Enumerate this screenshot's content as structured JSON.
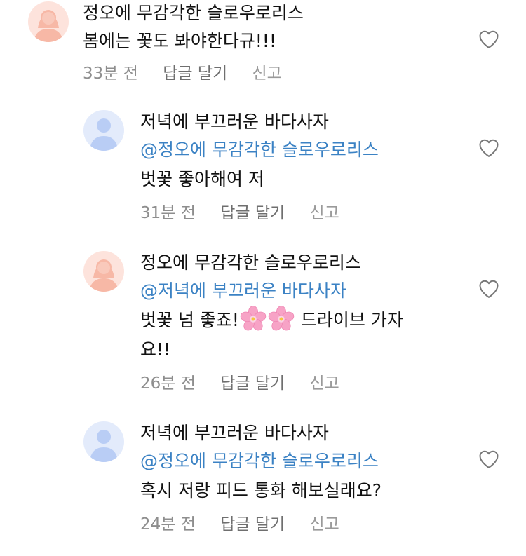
{
  "comments": [
    {
      "username": "정오에 무감각한 슬로우로리스",
      "text": "봄에는 꽃도 봐야한다규!!!",
      "time": "33분 전",
      "reply_label": "답글 달기",
      "report_label": "신고",
      "avatar_color": "#f7b8a6",
      "like_icon": "heart-outline-icon"
    }
  ],
  "replies": [
    {
      "username": "저녁에 부끄러운 바다사자",
      "mention": "@정오에 무감각한 슬로우로리스",
      "text": "벗꽃 좋아해여 저",
      "time": "31분 전",
      "reply_label": "답글 달기",
      "report_label": "신고",
      "avatar_color": "#b9cdf5",
      "like_icon": "heart-outline-icon"
    },
    {
      "username": "정오에 무감각한 슬로우로리스",
      "mention": "@저녁에 부끄러운 바다사자",
      "text_before": "벗꽃 넘 좋죠!",
      "emojis": [
        "cherry-blossom-icon",
        "cherry-blossom-icon"
      ],
      "text_after": " 드라이브 가자",
      "text_wrap": "요!!",
      "time": "26분 전",
      "reply_label": "답글 달기",
      "report_label": "신고",
      "avatar_color": "#f7b8a6",
      "like_icon": "heart-outline-icon"
    },
    {
      "username": "저녁에 부끄러운 바다사자",
      "mention": "@정오에 무감각한 슬로우로리스",
      "text": "혹시 저랑 피드 통화 해보실래요?",
      "time": "24분 전",
      "reply_label": "답글 달기",
      "report_label": "신고",
      "avatar_color": "#b9cdf5",
      "like_icon": "heart-outline-icon"
    }
  ],
  "colors": {
    "mention": "#3b82c4",
    "meta": "#8e8e8e",
    "text": "#111111"
  }
}
